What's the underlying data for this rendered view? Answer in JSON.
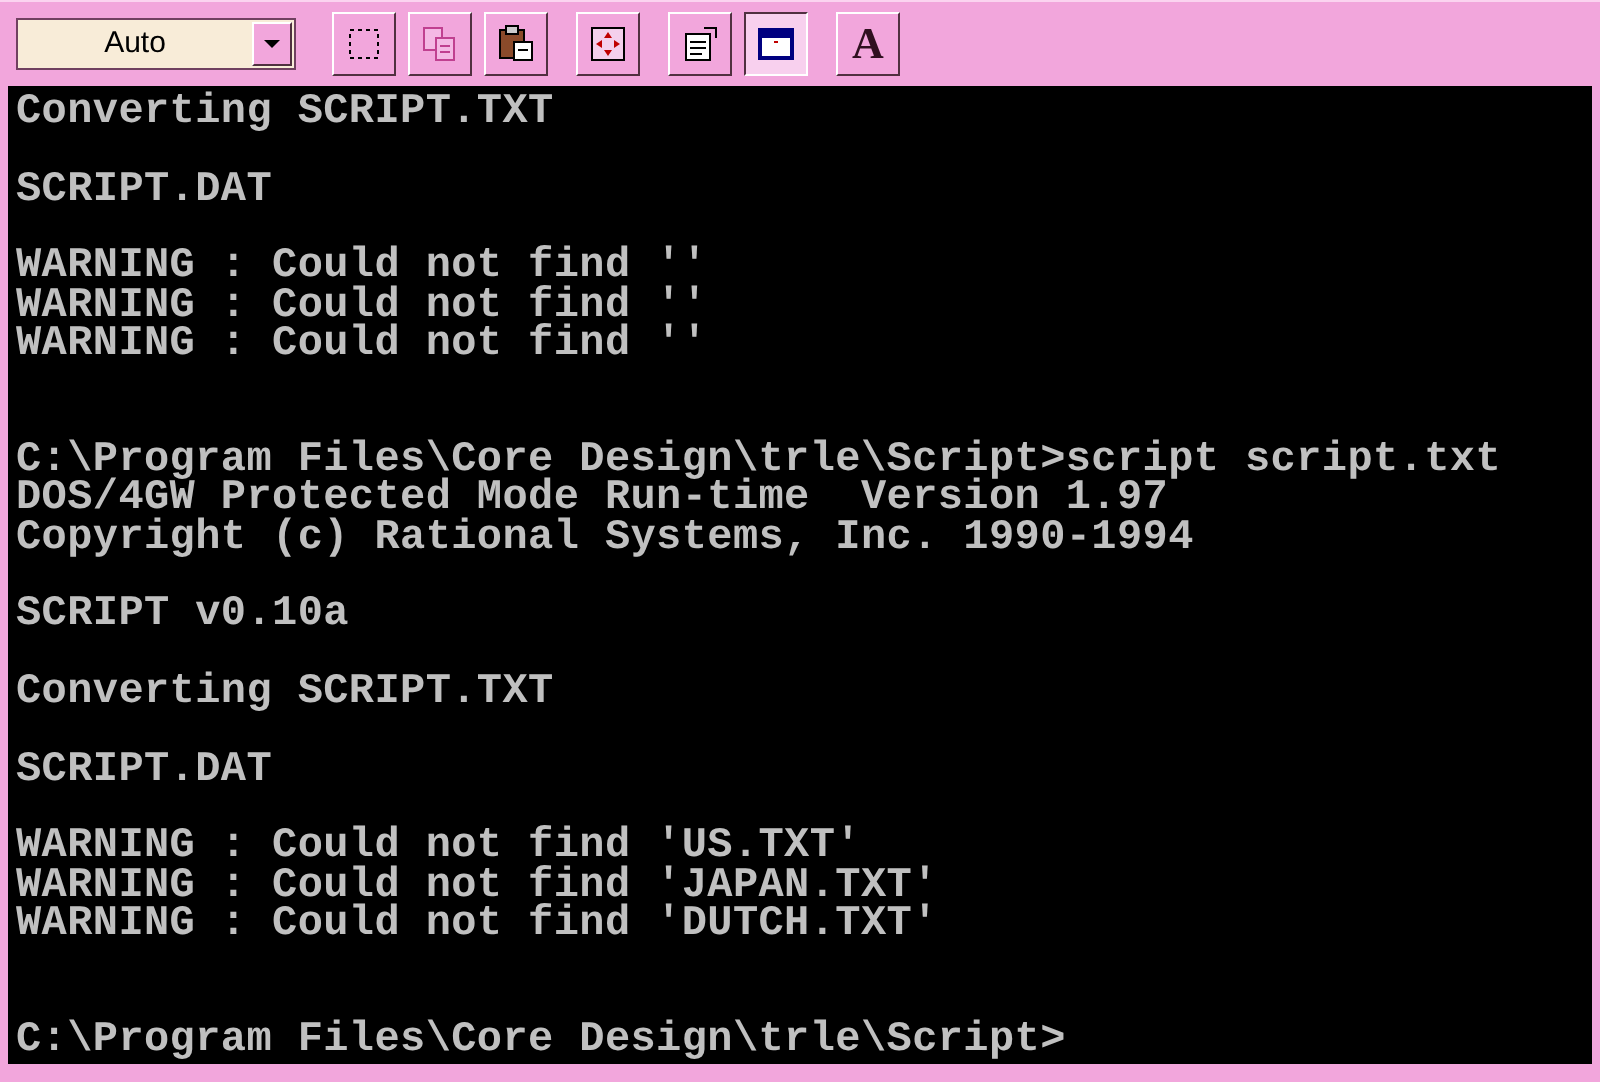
{
  "toolbar": {
    "font_size": {
      "value": "Auto"
    },
    "button_groups": [
      [
        {
          "kind": "mark",
          "selected": false
        },
        {
          "kind": "copy",
          "selected": false
        },
        {
          "kind": "paste",
          "selected": false
        }
      ],
      [
        {
          "kind": "fullscreen",
          "selected": false
        }
      ],
      [
        {
          "kind": "properties",
          "selected": false
        },
        {
          "kind": "background",
          "selected": true
        }
      ],
      [
        {
          "kind": "font",
          "selected": false,
          "label": "A"
        }
      ]
    ]
  },
  "console": {
    "lines": [
      {
        "kind": "text",
        "text": "Converting SCRIPT.TXT"
      },
      {
        "kind": "blank"
      },
      {
        "kind": "text",
        "text": "SCRIPT.DAT"
      },
      {
        "kind": "blank"
      },
      {
        "kind": "text",
        "text": "WARNING : Could not find ''"
      },
      {
        "kind": "text",
        "text": "WARNING : Could not find ''"
      },
      {
        "kind": "text",
        "text": "WARNING : Could not find ''"
      },
      {
        "kind": "blank"
      },
      {
        "kind": "blank"
      },
      {
        "kind": "text",
        "text": "C:\\Program Files\\Core Design\\trle\\Script>script script.txt"
      },
      {
        "kind": "text",
        "text": "DOS/4GW Protected Mode Run-time  Version 1.97"
      },
      {
        "kind": "text",
        "text": "Copyright (c) Rational Systems, Inc. 1990-1994"
      },
      {
        "kind": "blank"
      },
      {
        "kind": "text",
        "text": "SCRIPT v0.10a"
      },
      {
        "kind": "blank"
      },
      {
        "kind": "text",
        "text": "Converting SCRIPT.TXT"
      },
      {
        "kind": "blank"
      },
      {
        "kind": "text",
        "text": "SCRIPT.DAT"
      },
      {
        "kind": "blank"
      },
      {
        "kind": "text",
        "text": "WARNING : Could not find 'US.TXT'"
      },
      {
        "kind": "text",
        "text": "WARNING : Could not find 'JAPAN.TXT'"
      },
      {
        "kind": "text",
        "text": "WARNING : Could not find 'DUTCH.TXT'"
      },
      {
        "kind": "blank"
      },
      {
        "kind": "blank"
      },
      {
        "kind": "text",
        "text": "C:\\Program Files\\Core Design\\trle\\Script>"
      }
    ]
  }
}
